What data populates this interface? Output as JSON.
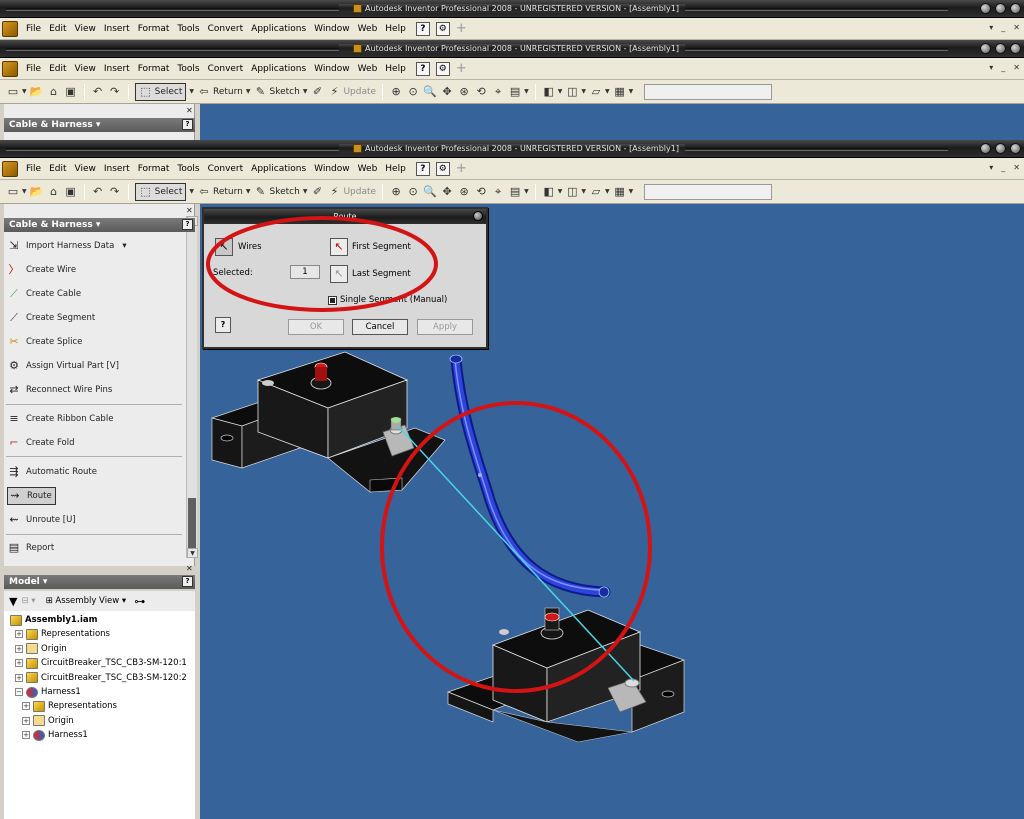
{
  "window": {
    "title": "Autodesk Inventor Professional 2008 - UNREGISTERED VERSION - [Assembly1]"
  },
  "menu": [
    "File",
    "Edit",
    "View",
    "Insert",
    "Format",
    "Tools",
    "Convert",
    "Applications",
    "Window",
    "Web",
    "Help"
  ],
  "toolbar": {
    "select_label": "Select",
    "return_label": "Return",
    "sketch_label": "Sketch",
    "update_label": "Update"
  },
  "cable_panel": {
    "title": "Cable & Harness",
    "tools": [
      {
        "label": "Import Harness Data",
        "icon": "import-harness-icon"
      },
      {
        "label": "Create Wire",
        "icon": "wire-icon"
      },
      {
        "label": "Create Cable",
        "icon": "cable-icon"
      },
      {
        "label": "Create Segment",
        "icon": "segment-icon"
      },
      {
        "label": "Create Splice",
        "icon": "splice-icon"
      },
      {
        "label": "Assign Virtual Part   [V]",
        "icon": "virtual-part-icon"
      },
      {
        "label": "Reconnect Wire Pins",
        "icon": "reconnect-icon"
      },
      {
        "label": "Create Ribbon Cable",
        "icon": "ribbon-cable-icon"
      },
      {
        "label": "Create Fold",
        "icon": "fold-icon"
      },
      {
        "label": "Automatic Route",
        "icon": "auto-route-icon"
      },
      {
        "label": "Route",
        "icon": "route-icon"
      },
      {
        "label": "Unroute    [U]",
        "icon": "unroute-icon"
      },
      {
        "label": "Report",
        "icon": "report-icon"
      }
    ]
  },
  "model_panel": {
    "title": "Model",
    "view_label": "Assembly View",
    "tree": [
      {
        "label": "Assembly1.iam",
        "level": 0,
        "icon": "assembly-icon",
        "expander": ""
      },
      {
        "label": "Representations",
        "level": 1,
        "icon": "representations-icon",
        "expander": "+"
      },
      {
        "label": "Origin",
        "level": 1,
        "icon": "folder-icon",
        "expander": "+"
      },
      {
        "label": "CircuitBreaker_TSC_CB3-SM-120:1",
        "level": 1,
        "icon": "part-icon",
        "expander": "+"
      },
      {
        "label": "CircuitBreaker_TSC_CB3-SM-120:2",
        "level": 1,
        "icon": "part-icon",
        "expander": "+"
      },
      {
        "label": "Harness1",
        "level": 1,
        "icon": "harness-icon",
        "expander": "−"
      },
      {
        "label": "Representations",
        "level": 2,
        "icon": "representations-icon",
        "expander": "+"
      },
      {
        "label": "Origin",
        "level": 2,
        "icon": "folder-icon",
        "expander": "+"
      },
      {
        "label": "Harness1",
        "level": 2,
        "icon": "harness-icon",
        "expander": "+"
      }
    ]
  },
  "route_dialog": {
    "title": "Route",
    "wires_label": "Wires",
    "selected_label": "Selected:",
    "selected_value": "1",
    "first_segment_label": "First Segment",
    "last_segment_label": "Last Segment",
    "single_segment_label": "Single Segment (Manual)",
    "ok_label": "OK",
    "cancel_label": "Cancel",
    "apply_label": "Apply",
    "help_label": "?"
  },
  "colors": {
    "viewport": "#35639a",
    "annotation": "#d41414",
    "harness_segment": "#1f34c8",
    "wire": "#48d6e6"
  }
}
